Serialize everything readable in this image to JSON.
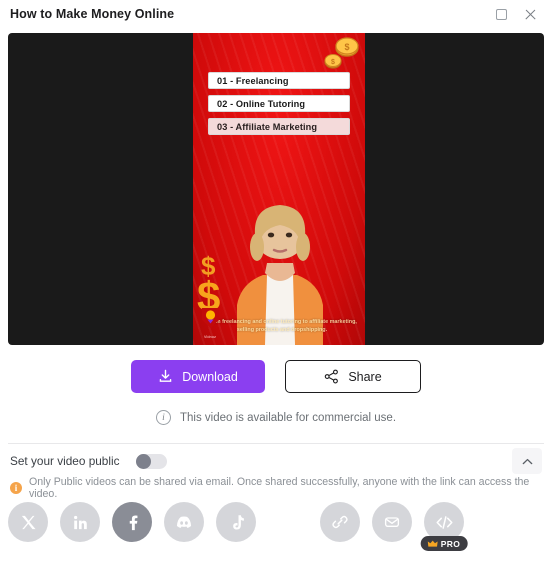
{
  "window": {
    "title": "How to Make Money Online",
    "maximize_icon": "maximize-square-icon",
    "close_icon": "close-x-icon"
  },
  "video": {
    "background_color": "#e00c0c",
    "letterbox_color": "#1a1a1a",
    "list_items": [
      {
        "label": "01 - Freelancing"
      },
      {
        "label": "02 - Online Tutoring"
      },
      {
        "label": "03 - Affiliate Marketing"
      }
    ],
    "caption": "From freelancing and online tutoring to affiliate marketing, selling products and dropshipping.",
    "watermark_text": "Vidnoz"
  },
  "actions": {
    "download_label": "Download",
    "download_icon": "download-icon",
    "download_color": "#8b3ff0",
    "share_label": "Share",
    "share_icon": "share-nodes-icon"
  },
  "note": {
    "icon": "info-circle-icon",
    "text": "This video is available for commercial use."
  },
  "visibility": {
    "label": "Set your video public",
    "toggle_state": "off",
    "collapse_icon": "chevron-up-icon"
  },
  "warning": {
    "icon": "warning-info-icon",
    "color": "#f5a44b",
    "text": "Only Public videos can be shared via email. Once shared successfully, anyone with the link can access the video."
  },
  "share_targets": {
    "social": [
      {
        "name": "x-twitter-icon",
        "active": false
      },
      {
        "name": "linkedin-icon",
        "active": false
      },
      {
        "name": "facebook-icon",
        "active": true
      },
      {
        "name": "discord-icon",
        "active": false
      },
      {
        "name": "tiktok-icon",
        "active": false
      }
    ],
    "utility": [
      {
        "name": "link-icon",
        "badge": ""
      },
      {
        "name": "email-icon",
        "badge": ""
      },
      {
        "name": "embed-code-icon",
        "badge": "PRO"
      }
    ],
    "pro_badge_label": "PRO"
  }
}
